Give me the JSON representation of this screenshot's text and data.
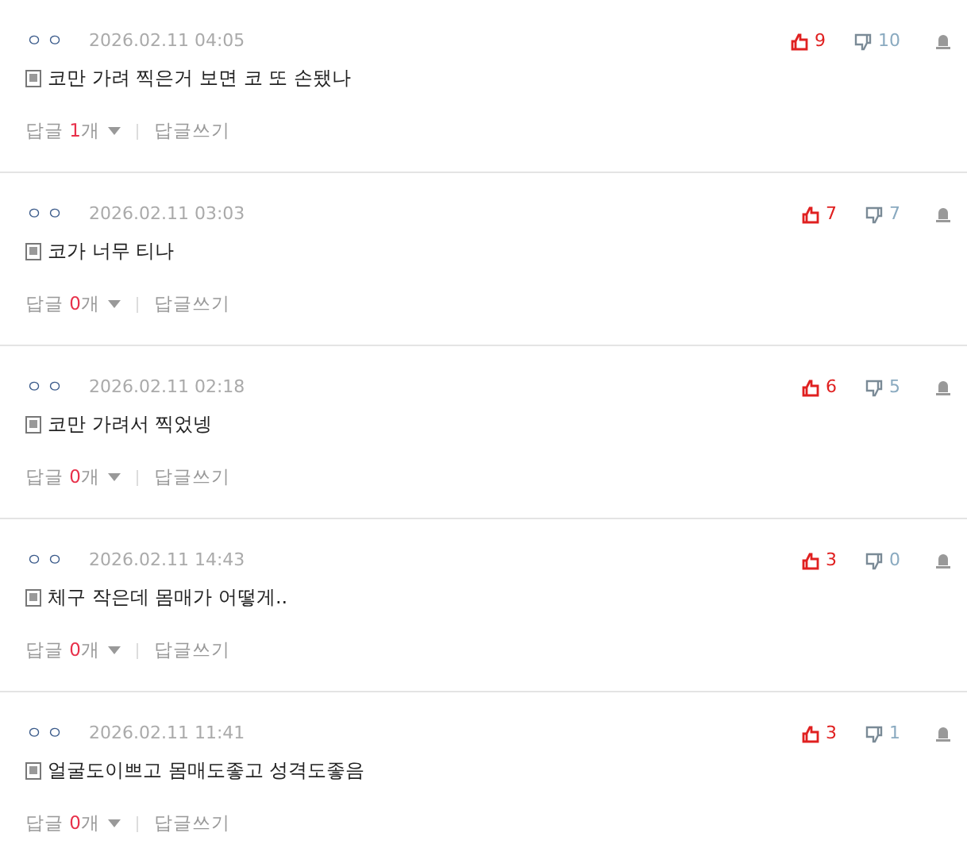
{
  "comments": [
    {
      "author": "ㅇㅇ",
      "date": "2026.02.11 04:05",
      "text": "코만 가려 찍은거 보면 코 또 손됐나",
      "likes": "9",
      "dislikes": "10",
      "reply_label": "답글",
      "reply_count": "1",
      "reply_unit": "개",
      "write_reply": "답글쓰기"
    },
    {
      "author": "ㅇㅇ",
      "date": "2026.02.11 03:03",
      "text": "코가 너무 티나",
      "likes": "7",
      "dislikes": "7",
      "reply_label": "답글",
      "reply_count": "0",
      "reply_unit": "개",
      "write_reply": "답글쓰기"
    },
    {
      "author": "ㅇㅇ",
      "date": "2026.02.11 02:18",
      "text": "코만 가려서 찍었넹",
      "likes": "6",
      "dislikes": "5",
      "reply_label": "답글",
      "reply_count": "0",
      "reply_unit": "개",
      "write_reply": "답글쓰기"
    },
    {
      "author": "ㅇㅇ",
      "date": "2026.02.11 14:43",
      "text": "체구 작은데 몸매가 어떻게..",
      "likes": "3",
      "dislikes": "0",
      "reply_label": "답글",
      "reply_count": "0",
      "reply_unit": "개",
      "write_reply": "답글쓰기"
    },
    {
      "author": "ㅇㅇ",
      "date": "2026.02.11 11:41",
      "text": "얼굴도이쁘고 몸매도좋고 성격도좋음",
      "likes": "3",
      "dislikes": "1",
      "reply_label": "답글",
      "reply_count": "0",
      "reply_unit": "개",
      "write_reply": "답글쓰기"
    }
  ]
}
